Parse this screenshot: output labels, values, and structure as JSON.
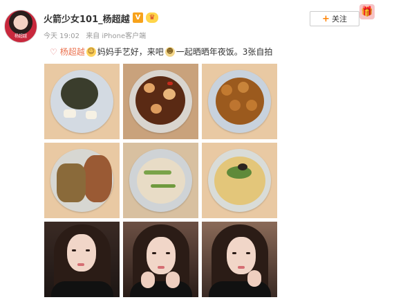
{
  "post": {
    "username": "火箭少女101_杨超越",
    "verified_badge": "V",
    "member_badge": "♛",
    "avatar_caption": "杨超越",
    "time": "今天 19:02",
    "source": "来自 iPhone客户端",
    "follow_label": "关注",
    "follow_icon": "+",
    "gift_icon": "gift-icon",
    "text": {
      "mention": "杨超越",
      "part1": "妈妈手艺好，来吧",
      "part2": "一起晒晒年夜饭。3张自拍"
    },
    "emoji": {
      "baby": "baby-emoji",
      "doge": "doge-emoji"
    },
    "photos": [
      {
        "name": "turtle-soup-photo"
      },
      {
        "name": "braised-scallops-photo"
      },
      {
        "name": "meatballs-photo"
      },
      {
        "name": "crab-photo"
      },
      {
        "name": "shrimp-stirfry-photo"
      },
      {
        "name": "vegetable-soup-photo"
      },
      {
        "name": "selfie-photo-1"
      },
      {
        "name": "selfie-photo-2"
      },
      {
        "name": "selfie-photo-3"
      }
    ]
  },
  "colors": {
    "accent": "#ff8200",
    "mention": "#eb7350",
    "meta": "#999999",
    "badge_v": "#f7a21b"
  }
}
